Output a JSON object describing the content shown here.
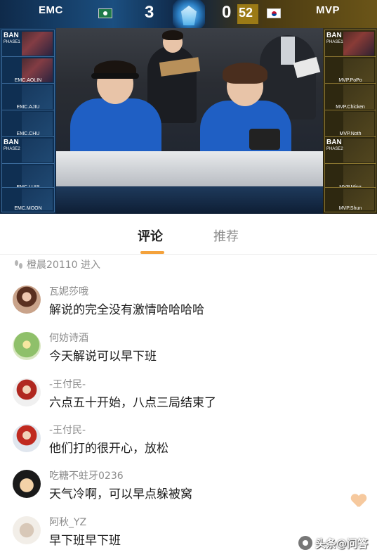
{
  "broadcast": {
    "team_left": "EMC",
    "team_right": "MVP",
    "score_left": "3",
    "score_right": "0",
    "timer": "52",
    "left_slots": [
      {
        "ban": "BAN",
        "phase": "PHASE1",
        "name": ""
      },
      {
        "ban": "",
        "phase": "",
        "name": "EMC.AOLIN"
      },
      {
        "ban": "",
        "phase": "",
        "name": "EMC.AJIU"
      },
      {
        "ban": "",
        "phase": "",
        "name": "EMC.CHU"
      },
      {
        "ban": "BAN",
        "phase": "PHASE2",
        "name": ""
      },
      {
        "ban": "",
        "phase": "",
        "name": "EMC.LUIS"
      },
      {
        "ban": "",
        "phase": "",
        "name": "EMC.MOON"
      }
    ],
    "right_slots": [
      {
        "ban": "BAN",
        "phase": "PHASE1",
        "name": ""
      },
      {
        "ban": "",
        "phase": "",
        "name": "MVP.PoPo"
      },
      {
        "ban": "",
        "phase": "",
        "name": "MVP.Chicken"
      },
      {
        "ban": "",
        "phase": "",
        "name": "MVP.Noth"
      },
      {
        "ban": "BAN",
        "phase": "PHASE2",
        "name": ""
      },
      {
        "ban": "",
        "phase": "",
        "name": "MVP.Ming"
      },
      {
        "ban": "",
        "phase": "",
        "name": "MVP.Shun"
      }
    ],
    "jersey_color": "#1f5fc4"
  },
  "tabs": {
    "comments": "评论",
    "recommend": "推荐",
    "active": "comments",
    "accent": "#f4a23c"
  },
  "join_notice": "橙晨20110 进入",
  "comments": [
    {
      "user": "瓦妮莎哦",
      "text": "解说的完全没有激情哈哈哈哈"
    },
    {
      "user": "何妨诗酒",
      "text": "今天解说可以早下班"
    },
    {
      "user": "-王付民-",
      "text": "六点五十开始，八点三局结束了"
    },
    {
      "user": "-王付民-",
      "text": "他们打的很开心，放松"
    },
    {
      "user": "吃糖不蛀牙0236",
      "text": "天气冷啊，可以早点躲被窝"
    },
    {
      "user": "阿秋_YZ",
      "text": "早下班早下班"
    }
  ],
  "icons": {
    "footprint": "footprint-icon",
    "like": "heart-icon"
  },
  "watermark": "头条@问答"
}
